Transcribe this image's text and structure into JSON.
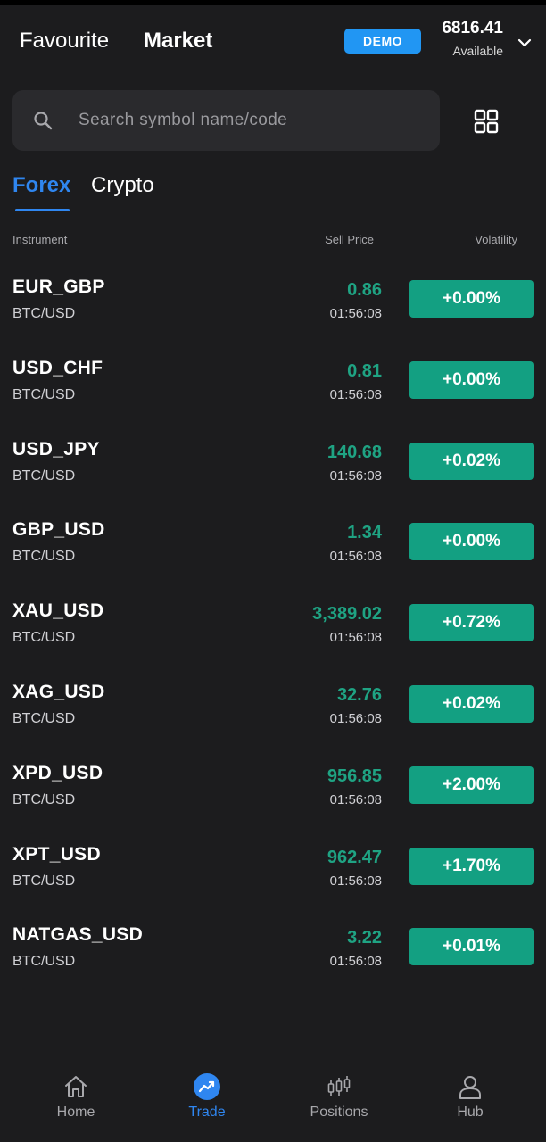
{
  "header": {
    "tabs": [
      {
        "label": "Favourite",
        "active": false
      },
      {
        "label": "Market",
        "active": true
      }
    ],
    "demo_badge": "DEMO",
    "balance": "6816.41",
    "balance_label": "Available"
  },
  "search": {
    "placeholder": "Search symbol name/code",
    "value": ""
  },
  "categories": [
    {
      "label": "Forex",
      "active": true
    },
    {
      "label": "Crypto",
      "active": false
    }
  ],
  "columns": {
    "instrument": "Instrument",
    "sell_price": "Sell Price",
    "volatility": "Volatility"
  },
  "instruments": [
    {
      "name": "EUR_GBP",
      "sub": "BTC/USD",
      "price": "0.86",
      "time": "01:56:08",
      "volatility": "+0.00%"
    },
    {
      "name": "USD_CHF",
      "sub": "BTC/USD",
      "price": "0.81",
      "time": "01:56:08",
      "volatility": "+0.00%"
    },
    {
      "name": "USD_JPY",
      "sub": "BTC/USD",
      "price": "140.68",
      "time": "01:56:08",
      "volatility": "+0.02%"
    },
    {
      "name": "GBP_USD",
      "sub": "BTC/USD",
      "price": "1.34",
      "time": "01:56:08",
      "volatility": "+0.00%"
    },
    {
      "name": "XAU_USD",
      "sub": "BTC/USD",
      "price": "3,389.02",
      "time": "01:56:08",
      "volatility": "+0.72%"
    },
    {
      "name": "XAG_USD",
      "sub": "BTC/USD",
      "price": "32.76",
      "time": "01:56:08",
      "volatility": "+0.02%"
    },
    {
      "name": "XPD_USD",
      "sub": "BTC/USD",
      "price": "956.85",
      "time": "01:56:08",
      "volatility": "+2.00%"
    },
    {
      "name": "XPT_USD",
      "sub": "BTC/USD",
      "price": "962.47",
      "time": "01:56:08",
      "volatility": "+1.70%"
    },
    {
      "name": "NATGAS_USD",
      "sub": "BTC/USD",
      "price": "3.22",
      "time": "01:56:08",
      "volatility": "+0.01%"
    }
  ],
  "nav": [
    {
      "label": "Home",
      "icon": "home-icon",
      "active": false
    },
    {
      "label": "Trade",
      "icon": "trade-icon",
      "active": true
    },
    {
      "label": "Positions",
      "icon": "candlestick-icon",
      "active": false
    },
    {
      "label": "Hub",
      "icon": "user-icon",
      "active": false
    }
  ],
  "colors": {
    "background": "#1c1c1e",
    "accent": "#2f86f0",
    "demo": "#2196f3",
    "up": "#1fa383",
    "volatility_bg": "#13a082"
  }
}
